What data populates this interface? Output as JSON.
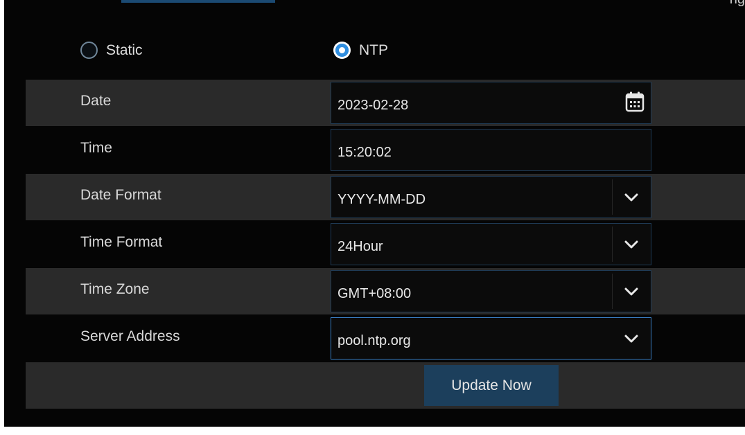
{
  "header": {
    "cut_text": "ng"
  },
  "mode": {
    "options": [
      {
        "label": "Static",
        "selected": false
      },
      {
        "label": "NTP",
        "selected": true
      }
    ]
  },
  "fields": {
    "date": {
      "label": "Date",
      "value": "2023-02-28",
      "icon": "calendar-icon"
    },
    "time": {
      "label": "Time",
      "value": "15:20:02"
    },
    "date_format": {
      "label": "Date Format",
      "value": "YYYY-MM-DD",
      "icon": "chevron-down-icon"
    },
    "time_format": {
      "label": "Time Format",
      "value": "24Hour",
      "icon": "chevron-down-icon"
    },
    "time_zone": {
      "label": "Time Zone",
      "value": "GMT+08:00",
      "icon": "chevron-down-icon"
    },
    "server_address": {
      "label": "Server Address",
      "value": "pool.ntp.org",
      "icon": "chevron-down-icon"
    }
  },
  "actions": {
    "update_now": "Update Now"
  },
  "colors": {
    "accent": "#2f8ee0",
    "row_shade": "#2a2a2a",
    "button_bg": "#1c3f5c",
    "field_border": "#1f3b56",
    "field_border_active": "#3a7fc4"
  }
}
